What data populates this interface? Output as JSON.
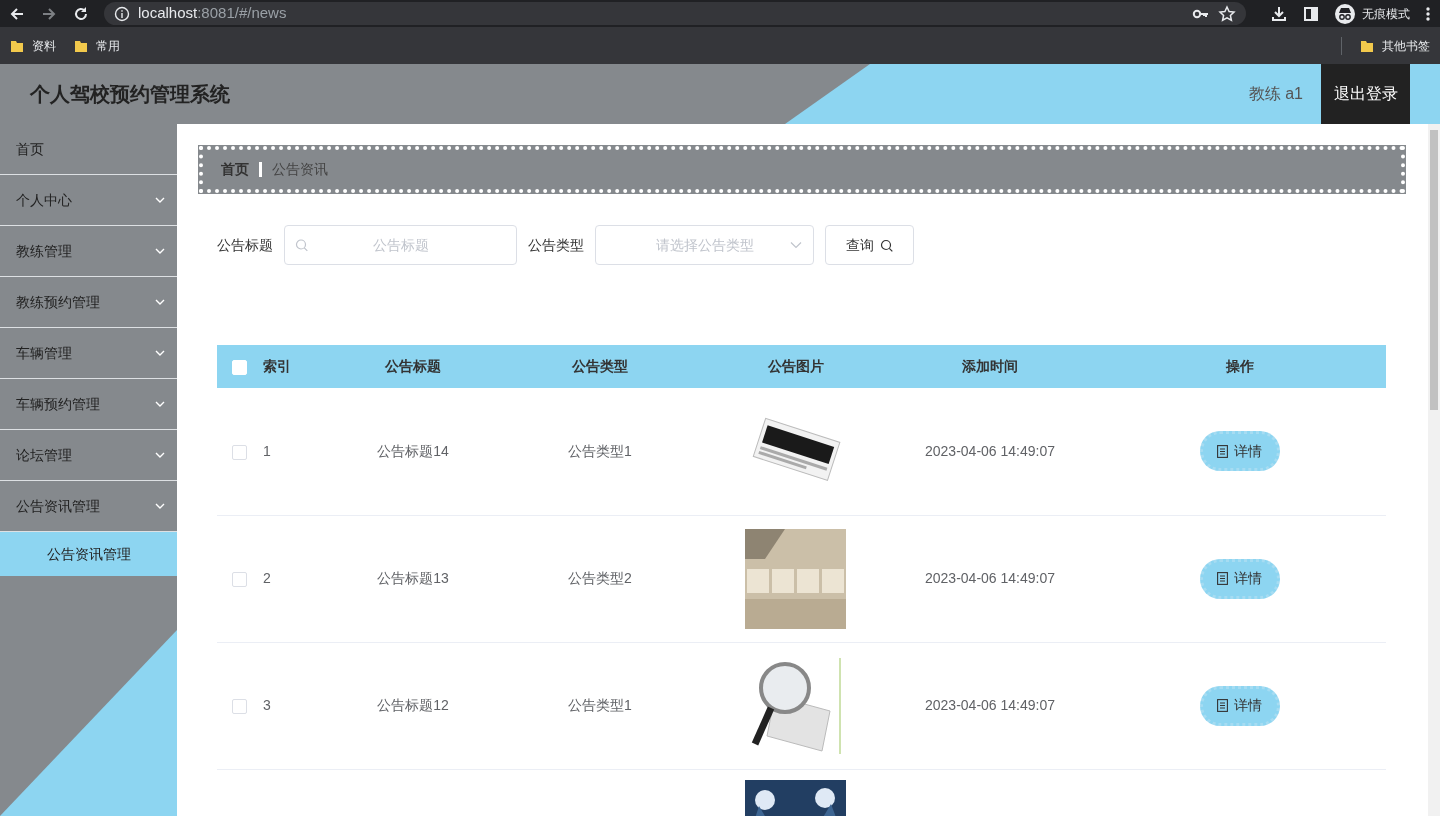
{
  "browser": {
    "url_host": "localhost",
    "url_path": ":8081/#/news",
    "forward_disabled": true,
    "profile_label": "无痕模式",
    "bookmarks": [
      "资料",
      "常用"
    ],
    "other_bookmarks": "其他书签"
  },
  "header": {
    "title": "个人驾校预约管理系统",
    "user": "教练 a1",
    "logout": "退出登录"
  },
  "sidebar": {
    "items": [
      {
        "label": "首页",
        "kind": "link",
        "selected": false
      },
      {
        "label": "个人中心",
        "kind": "submenu",
        "selected": false
      },
      {
        "label": "教练管理",
        "kind": "submenu",
        "selected": false
      },
      {
        "label": "教练预约管理",
        "kind": "submenu",
        "selected": false
      },
      {
        "label": "车辆管理",
        "kind": "submenu",
        "selected": false
      },
      {
        "label": "车辆预约管理",
        "kind": "submenu",
        "selected": false
      },
      {
        "label": "论坛管理",
        "kind": "submenu",
        "selected": false
      },
      {
        "label": "公告资讯管理",
        "kind": "submenu",
        "expanded": true,
        "selected": false,
        "children": [
          {
            "label": "公告资讯管理",
            "selected": true
          }
        ]
      }
    ]
  },
  "breadcrumb": [
    "首页",
    "公告资讯"
  ],
  "filters": [
    {
      "kind": "search",
      "label": "公告标题",
      "placeholder": "公告标题"
    },
    {
      "kind": "select",
      "label": "公告类型",
      "placeholder": "请选择公告类型"
    }
  ],
  "query_button": "查询",
  "table": {
    "select_all_checked": false,
    "columns": [
      "索引",
      "公告标题",
      "公告类型",
      "公告图片",
      "添加时间",
      "操作"
    ],
    "rows": [
      {
        "checked": false,
        "index": "1",
        "title": "公告标题14",
        "type": "公告类型1",
        "image": {
          "kind": "picture"
        },
        "added": "2023-04-06 14:49:07",
        "action": "详情"
      },
      {
        "checked": false,
        "index": "2",
        "title": "公告标题13",
        "type": "公告类型2",
        "image": {
          "kind": "picture"
        },
        "added": "2023-04-06 14:49:07",
        "action": "详情"
      },
      {
        "checked": false,
        "index": "3",
        "title": "公告标题12",
        "type": "公告类型1",
        "image": {
          "kind": "picture"
        },
        "added": "2023-04-06 14:49:07",
        "action": "详情"
      },
      {
        "image": {
          "kind": "picture"
        }
      }
    ]
  }
}
